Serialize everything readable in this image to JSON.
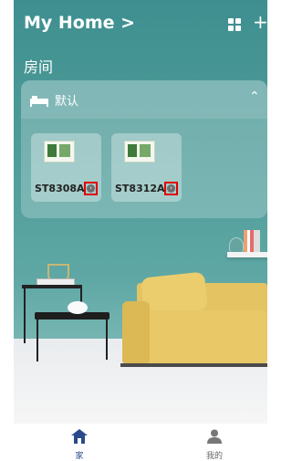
{
  "header": {
    "title": "My Home >"
  },
  "section": {
    "rooms_label": "房间"
  },
  "room": {
    "name": "默认",
    "devices": [
      {
        "name": "ST8308A"
      },
      {
        "name": "ST8312A"
      }
    ]
  },
  "nav": {
    "items": [
      {
        "label": "家"
      },
      {
        "label": "我的"
      }
    ]
  },
  "colors": {
    "accent": "#2b4a8b",
    "highlight": "#e00000"
  }
}
